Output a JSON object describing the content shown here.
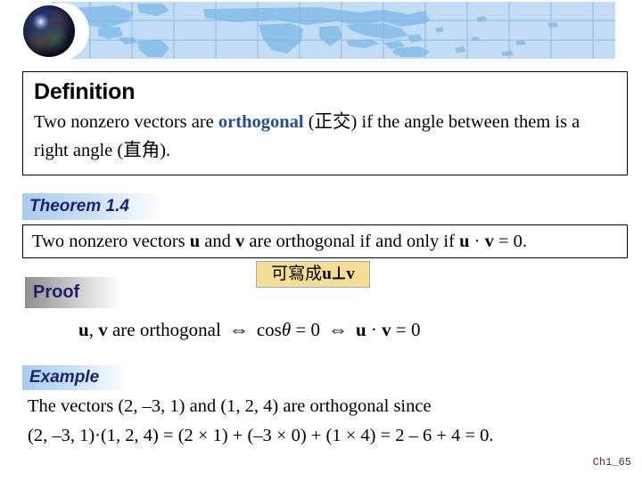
{
  "header": {
    "logo_icon": "globe-icon",
    "banner_icon": "world-map-banner",
    "banner_bg": "#c3ddf6",
    "banner_land": "#8fc3ea",
    "banner_grid": "#79b0e0"
  },
  "definition": {
    "heading": "Definition",
    "body_part1": "Two nonzero vectors are ",
    "keyword": "orthogonal",
    "body_part2": " (正交) if the angle between them is a right angle (直角).",
    "keyword_color": "#1f4e9c"
  },
  "theorem": {
    "banner_label": "Theorem 1.4",
    "statement_part1": "Two nonzero vectors ",
    "statement_u": "u",
    "statement_and": " and ",
    "statement_v": "v",
    "statement_part2": " are orthogonal if and only if ",
    "statement_u2": "u",
    "statement_dot": " · ",
    "statement_v2": "v",
    "statement_end": " = 0.",
    "banner_color": "#1a1f6e"
  },
  "proof": {
    "banner_label": "Proof",
    "eq_lhs_u": "u",
    "eq_lhs_comma": ", ",
    "eq_lhs_v": "v",
    "eq_lhs_text": " are orthogonal",
    "eq_iff1": "⇔",
    "eq_mid_cos": "cos",
    "eq_mid_theta": "θ",
    "eq_mid_eq": " = 0",
    "eq_iff2": "⇔",
    "eq_rhs_u": "u",
    "eq_rhs_dot": " · ",
    "eq_rhs_v": "v",
    "eq_rhs_eq": " = 0"
  },
  "callout": {
    "text_prefix": "可寫成",
    "text_u": "u",
    "text_perp": "⊥",
    "text_v": "v",
    "bg_color": "#f5dd94",
    "border_color": "#9aaabb"
  },
  "example": {
    "banner_label": "Example",
    "line1": "The vectors (2, –3, 1) and (1, 2, 4) are orthogonal since",
    "line2": "(2, –3, 1)·(1, 2, 4) = (2 × 1) + (–3 × 0) + (1 × 4) = 2 – 6 + 4 = 0."
  },
  "footer": {
    "label": "Ch1_65",
    "color": "#5a2a28"
  }
}
